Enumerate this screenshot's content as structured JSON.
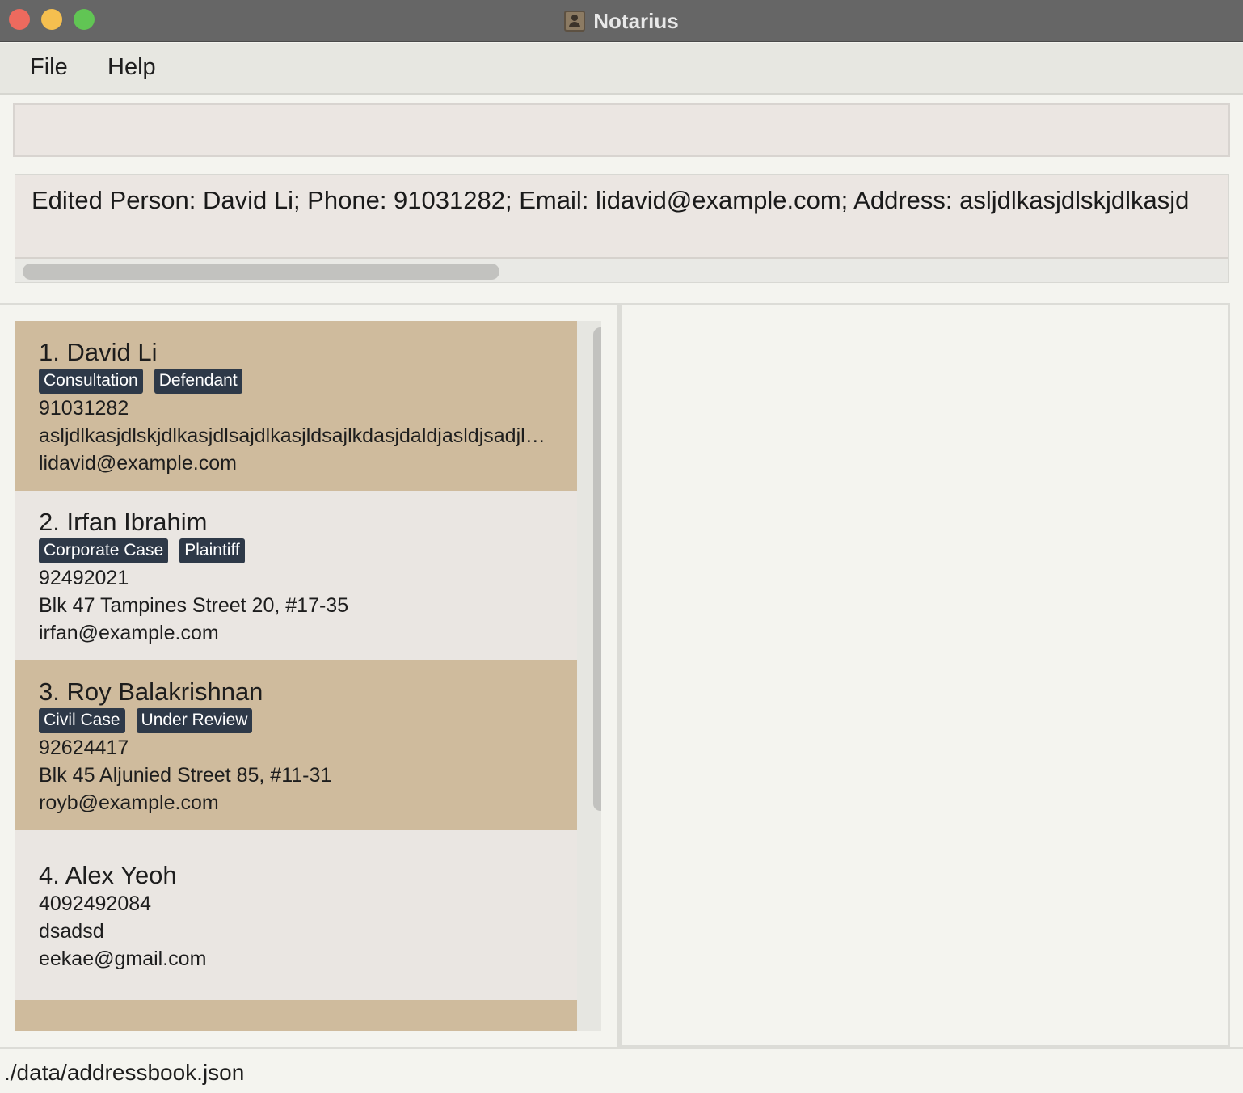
{
  "window": {
    "title": "Notarius"
  },
  "menu": {
    "file": "File",
    "help": "Help"
  },
  "command": {
    "value": "",
    "placeholder": ""
  },
  "result": {
    "text": "Edited Person: David Li; Phone: 91031282; Email: lidavid@example.com; Address: asljdlkasjdlskjdlkasjd"
  },
  "persons": [
    {
      "name": "1. David Li",
      "tags": [
        "Consultation",
        "Defendant"
      ],
      "phone": "91031282",
      "address": "asljdlkasjdlskjdlkasjdlsajdlkasjldsajlkdasjdaldjasldjsadjlsf...",
      "email": "lidavid@example.com"
    },
    {
      "name": "2. Irfan Ibrahim",
      "tags": [
        "Corporate Case",
        "Plaintiff"
      ],
      "phone": "92492021",
      "address": "Blk 47 Tampines Street 20, #17-35",
      "email": "irfan@example.com"
    },
    {
      "name": "3. Roy Balakrishnan",
      "tags": [
        "Civil Case",
        "Under Review"
      ],
      "phone": "92624417",
      "address": "Blk 45 Aljunied Street 85, #11-31",
      "email": "royb@example.com"
    },
    {
      "name": "4. Alex Yeoh",
      "tags": [],
      "phone": "4092492084",
      "address": "dsadsd",
      "email": "eekae@gmail.com"
    }
  ],
  "status": {
    "path": "./data/addressbook.json"
  }
}
